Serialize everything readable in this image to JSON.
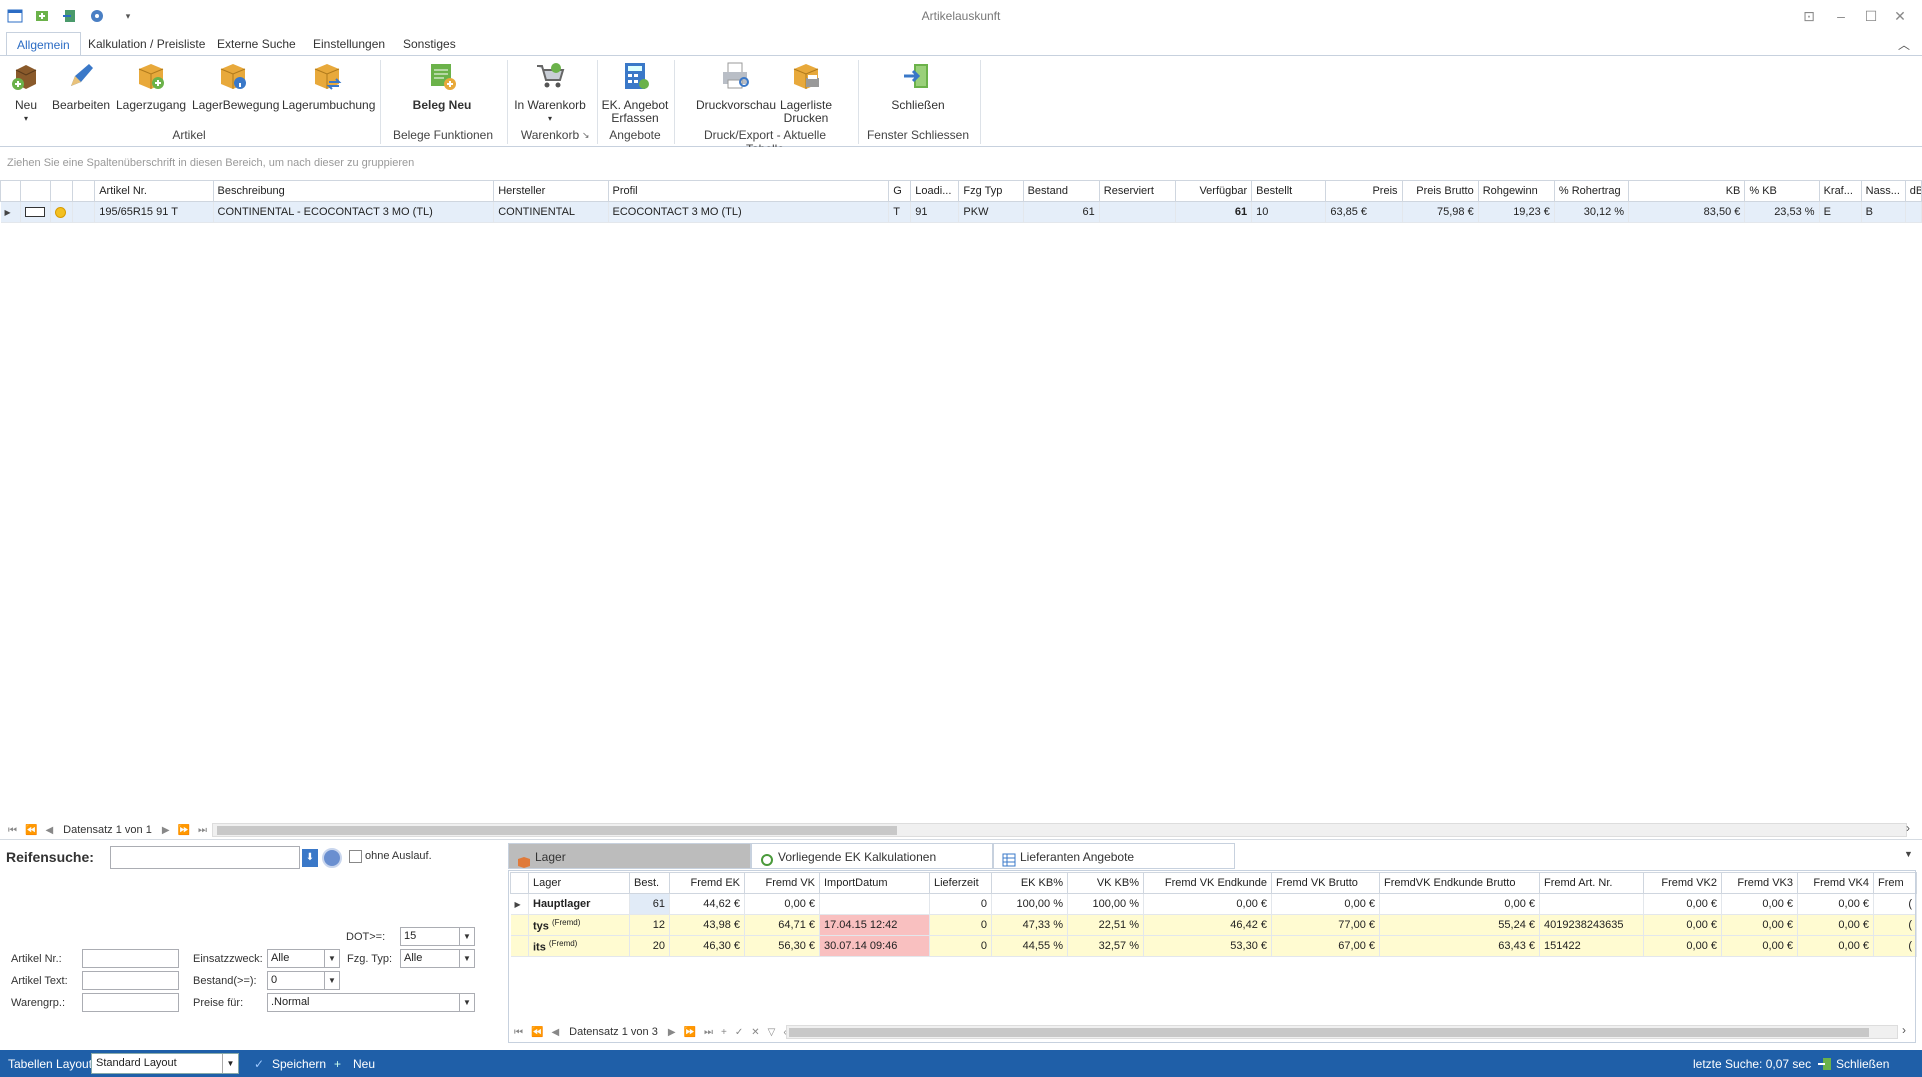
{
  "window": {
    "title": "Artikelauskunft"
  },
  "tabs": [
    "Allgemein",
    "Kalkulation / Preisliste",
    "Externe Suche",
    "Einstellungen",
    "Sonstiges"
  ],
  "ribbon": {
    "buttons": {
      "neu": "Neu",
      "bearbeiten": "Bearbeiten",
      "lagerzugang": "Lagerzugang",
      "lagerbewegung": "LagerBewegung",
      "lagerumbuchung": "Lagerumbuchung",
      "beleg_neu": "Beleg Neu",
      "warenkorb": "In Warenkorb",
      "ek_angebot_1": "EK. Angebot",
      "ek_angebot_2": "Erfassen",
      "druckvorschau": "Druckvorschau",
      "lagerliste_1": "Lagerliste",
      "lagerliste_2": "Drucken",
      "schliessen": "Schließen"
    },
    "groups": {
      "artikel": "Artikel",
      "belege": "Belege Funktionen",
      "warenkorb": "Warenkorb",
      "angebote": "Angebote",
      "druck": "Druck/Export - Aktuelle Tabelle",
      "fenster": "Fenster Schliessen"
    }
  },
  "groupby_hint": "Ziehen Sie eine Spaltenüberschrift in diesen Bereich, um nach dieser zu gruppieren",
  "main_grid": {
    "columns": [
      "Artikel Nr.",
      "Beschreibung",
      "Hersteller",
      "Profil",
      "G",
      "Loadi...",
      "Fzg Typ",
      "Bestand",
      "Reserviert",
      "Verfügbar",
      "Bestellt",
      "Preis",
      "Preis Brutto",
      "Rohgewinn",
      "% Rohertrag",
      "KB",
      "% KB",
      "Kraf...",
      "Nass...",
      "dB"
    ],
    "rows": [
      [
        "195/65R15 91 T",
        "CONTINENTAL - ECOCONTACT 3 MO (TL)",
        "CONTINENTAL",
        "ECOCONTACT 3 MO (TL)",
        "T",
        "91",
        "PKW",
        "61",
        "",
        "61",
        "10",
        "63,85 €",
        "75,98 €",
        "19,23 €",
        "30,12 %",
        "83,50 €",
        "23,53 %",
        "E",
        "B",
        ""
      ]
    ],
    "nav_text": "Datensatz 1 von 1"
  },
  "search": {
    "title": "Reifensuche:",
    "ohne_auslauf": "ohne Auslauf.",
    "dot_label": "DOT>=:",
    "dot_value": "15",
    "artikel_nr_label": "Artikel Nr.:",
    "artikel_text_label": "Artikel Text:",
    "warengrp_label": "Warengrp.:",
    "einsatzzweck_label": "Einsatzzweck:",
    "einsatzzweck_value": "Alle",
    "fzg_typ_label": "Fzg. Typ:",
    "fzg_typ_value": "Alle",
    "bestand_label": "Bestand(>=):",
    "bestand_value": "0",
    "preise_label": "Preise für:",
    "preise_value": ".Normal"
  },
  "bottom_tabs": [
    "Lager",
    "Vorliegende EK Kalkulationen",
    "Lieferanten Angebote"
  ],
  "lager_grid": {
    "columns": [
      "Lager",
      "Best.",
      "Fremd EK",
      "Fremd VK",
      "ImportDatum",
      "Lieferzeit",
      "EK KB%",
      "VK KB%",
      "Fremd VK Endkunde",
      "Fremd VK Brutto",
      "FremdVK Endkunde Brutto",
      "Fremd Art. Nr.",
      "Fremd VK2",
      "Fremd VK3",
      "Fremd VK4",
      "Frem"
    ],
    "rows": [
      {
        "lager": "Hauptlager",
        "tag": "",
        "cells": [
          "61",
          "44,62 €",
          "0,00 €",
          "",
          "0",
          "100,00 %",
          "100,00 %",
          "0,00 €",
          "0,00 €",
          "0,00 €",
          "",
          "0,00 €",
          "0,00 €",
          "0,00 €",
          "("
        ]
      },
      {
        "lager": "tys",
        "tag": "(Fremd)",
        "cells": [
          "12",
          "43,98 €",
          "64,71 €",
          "17.04.15 12:42",
          "0",
          "47,33 %",
          "22,51 %",
          "46,42 €",
          "77,00 €",
          "55,24 €",
          "4019238243635",
          "0,00 €",
          "0,00 €",
          "0,00 €",
          "("
        ]
      },
      {
        "lager": "its",
        "tag": "(Fremd)",
        "cells": [
          "20",
          "46,30 €",
          "56,30 €",
          "30.07.14 09:46",
          "0",
          "44,55 %",
          "32,57 %",
          "53,30 €",
          "67,00 €",
          "63,43 €",
          "151422",
          "0,00 €",
          "0,00 €",
          "0,00 €",
          "("
        ]
      }
    ],
    "nav_text": "Datensatz 1 von 3"
  },
  "statusbar": {
    "layout_label": "Tabellen Layout:",
    "layout_value": "Standard Layout",
    "speichern": "Speichern",
    "neu": "Neu",
    "letzte_suche": "letzte Suche: 0,07 sec",
    "schliessen": "Schließen"
  },
  "colors": {
    "accent": "#2b6cc4",
    "statusbar": "#1f5fa8",
    "row_selected": "#e5eef9",
    "row_foreign": "#fffbd1",
    "date_highlight": "#f9c0c0"
  }
}
